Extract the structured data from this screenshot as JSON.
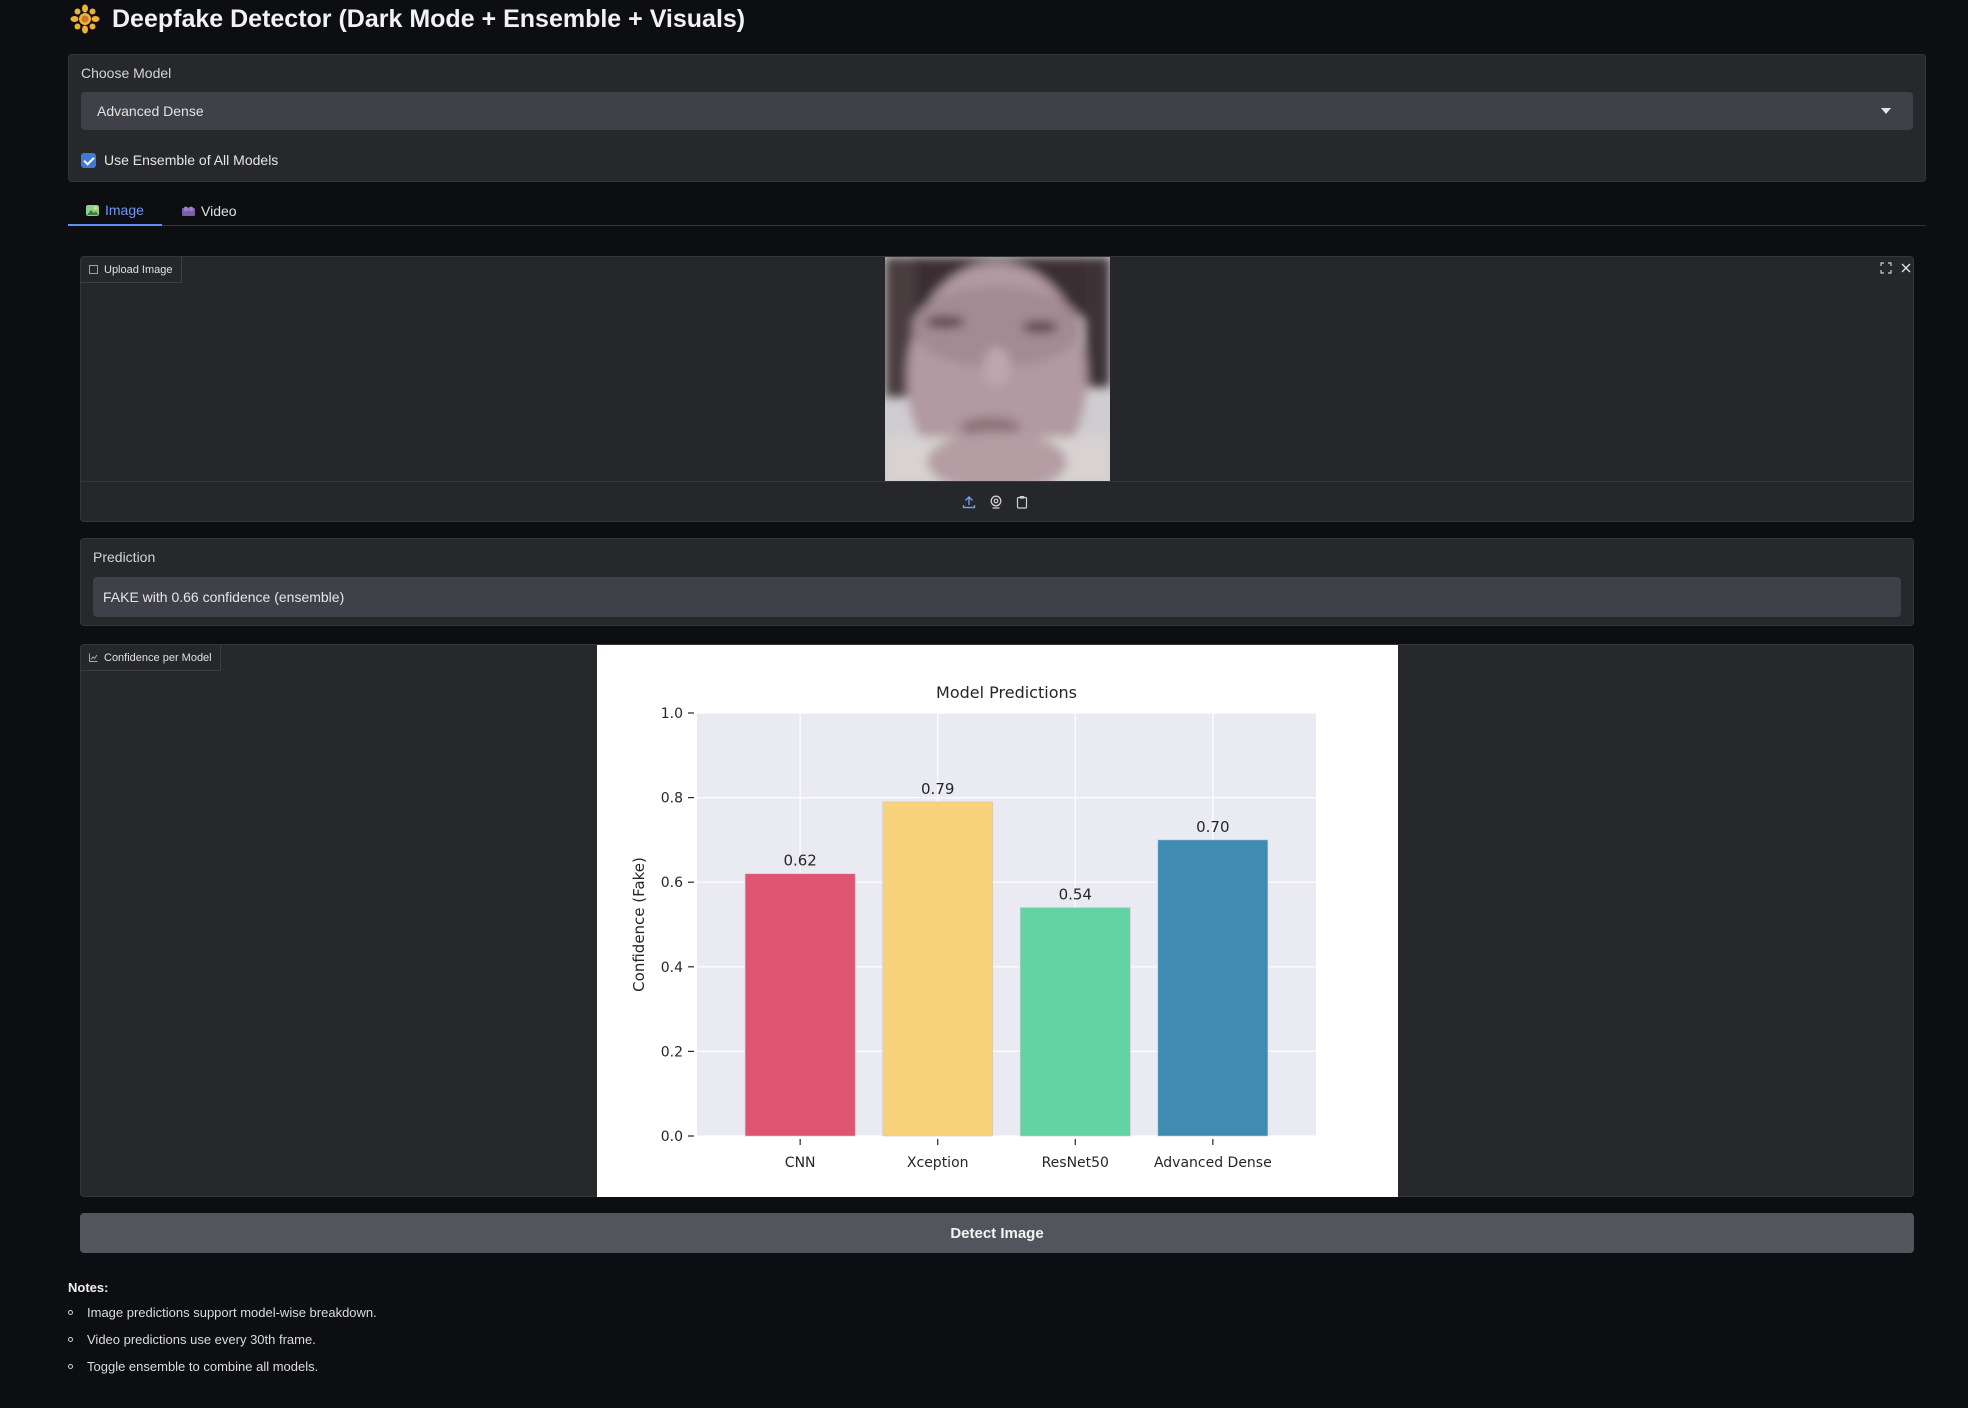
{
  "header": {
    "title": "Deepfake Detector (Dark Mode + Ensemble + Visuals)",
    "icon": "sun-flower-icon"
  },
  "model_selector": {
    "label": "Choose Model",
    "selected": "Advanced Dense",
    "ensemble_label": "Use Ensemble of All Models",
    "ensemble_checked": true
  },
  "tabs": [
    {
      "label": "Image",
      "icon": "image-icon",
      "active": true
    },
    {
      "label": "Video",
      "icon": "video-icon",
      "active": false
    }
  ],
  "upload": {
    "label": "Upload Image",
    "toolbar_icons": [
      "upload-icon",
      "webcam-icon",
      "clipboard-icon"
    ],
    "corner_icons": [
      "fullscreen-icon",
      "close-icon"
    ]
  },
  "prediction": {
    "label": "Prediction",
    "value": "FAKE with 0.66 confidence (ensemble)"
  },
  "chart_panel": {
    "label": "Confidence per Model"
  },
  "chart_data": {
    "type": "bar",
    "title": "Model Predictions",
    "xlabel": "",
    "ylabel": "Confidence (Fake)",
    "ylim": [
      0,
      1.0
    ],
    "yticks": [
      "0.0",
      "0.2",
      "0.4",
      "0.6",
      "0.8",
      "1.0"
    ],
    "categories": [
      "CNN",
      "Xception",
      "ResNet50",
      "Advanced Dense"
    ],
    "values": [
      0.62,
      0.79,
      0.54,
      0.7
    ],
    "value_labels": [
      "0.62",
      "0.79",
      "0.54",
      "0.70"
    ],
    "colors": [
      "#de5571",
      "#f8d27a",
      "#62d3a2",
      "#3f8bb2"
    ],
    "grid": true
  },
  "actions": {
    "detect_label": "Detect Image"
  },
  "notes": {
    "title": "Notes:",
    "items": [
      "Image predictions support model-wise breakdown.",
      "Video predictions use every 30th frame.",
      "Toggle ensemble to combine all models."
    ]
  }
}
